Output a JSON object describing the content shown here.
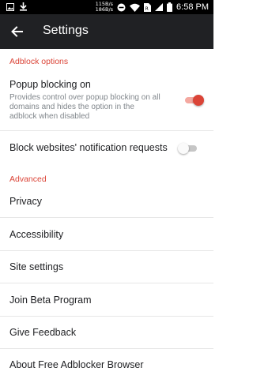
{
  "status_bar": {
    "net_up": "115B/s",
    "net_down": "186B/s",
    "time": "6:58 PM",
    "icons": [
      "image-icon",
      "download-icon",
      "dnd-icon",
      "wifi-icon",
      "sim-icon",
      "signal-icon",
      "battery-icon"
    ]
  },
  "app_bar": {
    "title": "Settings",
    "background": "#202124"
  },
  "sections": {
    "adblock_header": "Adblock options",
    "advanced_header": "Advanced",
    "accent": "#db4437"
  },
  "popup_blocking": {
    "title": "Popup blocking on",
    "summary": "Provides control over popup blocking on all domains and hides the option in the adblock when disabled",
    "enabled": true
  },
  "notification_block": {
    "title": "Block websites' notification requests",
    "enabled": false
  },
  "advanced_items": [
    {
      "label": "Privacy"
    },
    {
      "label": "Accessibility"
    },
    {
      "label": "Site settings"
    },
    {
      "label": "Join Beta Program"
    },
    {
      "label": "Give Feedback"
    },
    {
      "label": "About Free Adblocker Browser"
    }
  ]
}
